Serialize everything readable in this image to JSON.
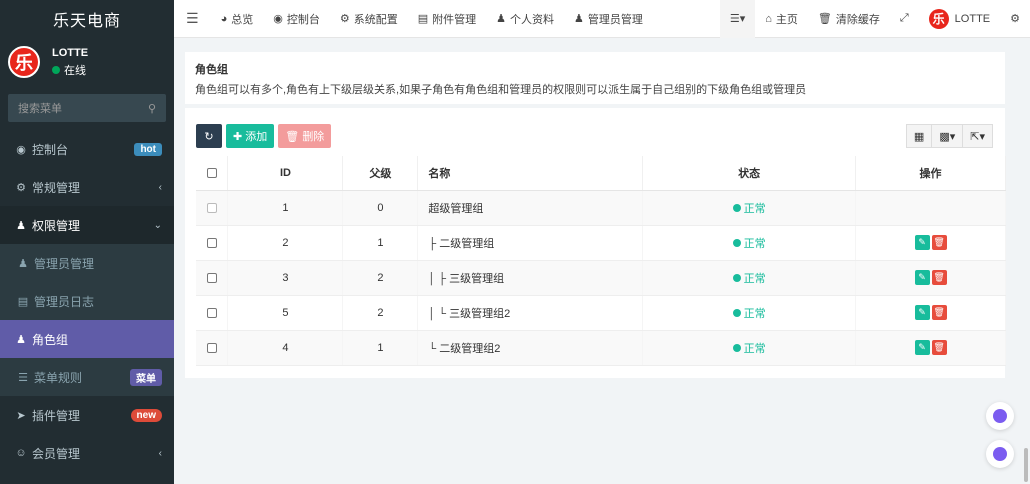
{
  "brand": "乐天电商",
  "user": {
    "name": "LOTTE",
    "status": "在线",
    "avatar_text": "乐"
  },
  "search": {
    "placeholder": "搜索菜单"
  },
  "sidebar": {
    "items": [
      {
        "label": "控制台",
        "badge": "hot"
      },
      {
        "label": "常规管理"
      },
      {
        "label": "权限管理"
      },
      {
        "label": "管理员管理"
      },
      {
        "label": "管理员日志"
      },
      {
        "label": "角色组"
      },
      {
        "label": "菜单规则",
        "badge": "菜单"
      },
      {
        "label": "插件管理",
        "badge": "new"
      },
      {
        "label": "会员管理"
      }
    ]
  },
  "topbar": {
    "tabs": [
      "总览",
      "控制台",
      "系统配置",
      "附件管理",
      "个人资料",
      "管理员管理"
    ],
    "home": "主页",
    "clear_cache": "清除缓存",
    "user": "LOTTE"
  },
  "panel": {
    "title": "角色组",
    "description": "角色组可以有多个,角色有上下级层级关系,如果子角色有角色组和管理员的权限则可以派生属于自己组别的下级角色组或管理员"
  },
  "toolbar": {
    "add_label": "添加",
    "delete_label": "删除"
  },
  "table": {
    "headers": {
      "id": "ID",
      "parent": "父级",
      "name": "名称",
      "status": "状态",
      "ops": "操作"
    },
    "rows": [
      {
        "id": "1",
        "parent": "0",
        "name": "超级管理组",
        "status": "正常",
        "editable": false
      },
      {
        "id": "2",
        "parent": "1",
        "name": "├ 二级管理组",
        "status": "正常",
        "editable": true
      },
      {
        "id": "3",
        "parent": "2",
        "name": "│ ├ 三级管理组",
        "status": "正常",
        "editable": true
      },
      {
        "id": "5",
        "parent": "2",
        "name": "│ └ 三级管理组2",
        "status": "正常",
        "editable": true
      },
      {
        "id": "4",
        "parent": "1",
        "name": "└ 二级管理组2",
        "status": "正常",
        "editable": true
      }
    ]
  },
  "colors": {
    "sidebar": "#222d32",
    "active": "#605ca8",
    "success": "#18bc9c",
    "danger": "#e74c3c"
  }
}
